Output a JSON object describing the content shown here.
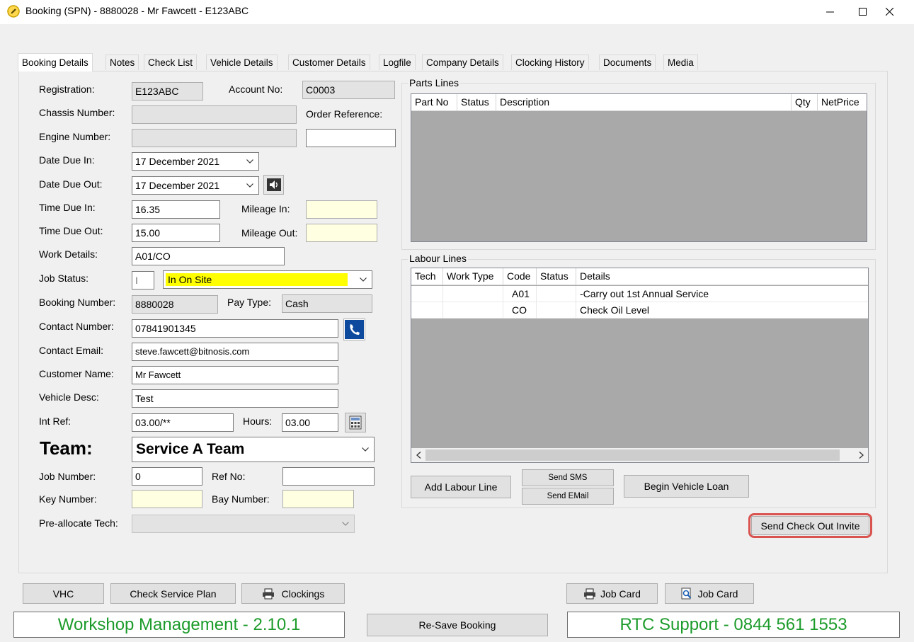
{
  "window": {
    "title": "Booking (SPN) - 8880028 - Mr Fawcett - E123ABC"
  },
  "tabs": [
    {
      "label": "Booking Details",
      "active": true
    },
    {
      "label": "Notes"
    },
    {
      "label": "Check List"
    },
    {
      "label": "Vehicle Details"
    },
    {
      "label": "Customer Details"
    },
    {
      "label": "Logfile"
    },
    {
      "label": "Company Details"
    },
    {
      "label": "Clocking History"
    },
    {
      "label": "Documents"
    },
    {
      "label": "Media"
    }
  ],
  "form": {
    "registration_label": "Registration:",
    "registration": "E123ABC",
    "account_no_label": "Account No:",
    "account_no": "C0003",
    "chassis_label": "Chassis Number:",
    "chassis": "",
    "order_ref_label": "Order Reference:",
    "order_ref": "",
    "engine_label": "Engine Number:",
    "engine": "",
    "date_due_in_label": "Date Due In:",
    "date_due_in": "17 December 2021",
    "date_due_out_label": "Date Due Out:",
    "date_due_out": "17 December 2021",
    "time_due_in_label": "Time Due In:",
    "time_due_in": "16.35",
    "mileage_in_label": "Mileage In:",
    "mileage_in": "",
    "time_due_out_label": "Time Due Out:",
    "time_due_out": "15.00",
    "mileage_out_label": "Mileage Out:",
    "mileage_out": "",
    "work_details_label": "Work Details:",
    "work_details": "A01/CO",
    "job_status_label": "Job Status:",
    "job_status_code": "I",
    "job_status": "In On Site",
    "booking_number_label": "Booking Number:",
    "booking_number": "8880028",
    "pay_type_label": "Pay Type:",
    "pay_type": "Cash",
    "contact_number_label": "Contact Number:",
    "contact_number": "07841901345",
    "contact_email_label": "Contact Email:",
    "contact_email": "steve.fawcett@bitnosis.com",
    "customer_name_label": "Customer Name:",
    "customer_name": "Mr Fawcett",
    "vehicle_desc_label": "Vehicle Desc:",
    "vehicle_desc": "Test",
    "int_ref_label": "Int Ref:",
    "int_ref": "03.00/**",
    "hours_label": "Hours:",
    "hours": "03.00",
    "team_label": "Team:",
    "team": "Service A Team",
    "job_number_label": "Job Number:",
    "job_number": "0",
    "ref_no_label": "Ref No:",
    "ref_no": "",
    "key_number_label": "Key Number:",
    "key_number": "",
    "bay_number_label": "Bay Number:",
    "bay_number": "",
    "preallocate_label": "Pre-allocate Tech:",
    "preallocate": ""
  },
  "parts": {
    "title": "Parts Lines",
    "columns": [
      "Part No",
      "Status",
      "Description",
      "Qty",
      "NetPrice"
    ],
    "rows": []
  },
  "labour": {
    "title": "Labour Lines",
    "columns": [
      "Tech",
      "Work Type",
      "Code",
      "Status",
      "Details"
    ],
    "rows": [
      [
        "",
        "",
        "A01",
        "",
        "-Carry out 1st Annual Service"
      ],
      [
        "",
        "",
        "CO",
        "",
        "Check Oil Level"
      ]
    ]
  },
  "buttons": {
    "add_labour": "Add Labour Line",
    "send_sms": "Send SMS",
    "send_email": "Send EMail",
    "begin_loan": "Begin Vehicle Loan",
    "send_checkout": "Send Check Out Invite",
    "vhc": "VHC",
    "check_service_plan": "Check Service Plan",
    "clockings": "Clockings",
    "job_card_print": "Job Card",
    "job_card_preview": "Job Card",
    "resave": "Re-Save Booking"
  },
  "status": {
    "left": "Workshop Management - 2.10.1",
    "right": "RTC Support - 0844 561 1553"
  },
  "colors": {
    "job_status_highlight": "#ffff00",
    "status_text": "#1c9b2b",
    "highlight_ring": "#d9534f",
    "readonly_bg": "#e3e3e3",
    "pending_bg": "#ffffe1"
  },
  "icons": {
    "app": "edit-circle-icon",
    "speaker": "speaker-icon",
    "phone": "phone-icon",
    "calculator": "calculator-icon",
    "printer": "printer-icon",
    "preview": "preview-icon"
  }
}
